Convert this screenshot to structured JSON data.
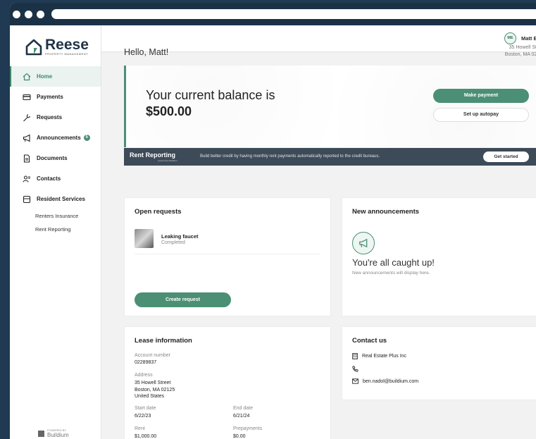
{
  "brand": {
    "name": "Reese",
    "tagline": "PROPERTY MANAGEMENT",
    "accent": "#4b8f75"
  },
  "sidebar": {
    "items": [
      {
        "label": "Home",
        "icon": "home-icon",
        "active": true
      },
      {
        "label": "Payments",
        "icon": "credit-card-icon"
      },
      {
        "label": "Requests",
        "icon": "wrench-icon"
      },
      {
        "label": "Announcements",
        "icon": "megaphone-icon",
        "badge": "5"
      },
      {
        "label": "Documents",
        "icon": "document-icon"
      },
      {
        "label": "Contacts",
        "icon": "contacts-icon"
      },
      {
        "label": "Resident Services",
        "icon": "services-icon"
      }
    ],
    "sub_items": [
      "Renters Insurance",
      "Rent Reporting"
    ],
    "powered_by": {
      "small": "POWERED BY",
      "name": "Buildium"
    }
  },
  "topbar": {
    "initials": "ME",
    "username": "Matt E"
  },
  "main": {
    "greeting": "Hello, Matt!",
    "address_line1": "35 Howell Street",
    "address_line2": "Boston, MA 02125"
  },
  "balance": {
    "label": "Your current balance is",
    "amount": "$500.00",
    "pay_button": "Make payment",
    "autopay_button": "Set up autopay"
  },
  "rent_reporting": {
    "title": "Rent Reporting",
    "powered": "powered by Buildium",
    "text": "Build better credit by having monthly rent payments automatically reported to the credit bureaus.",
    "button": "Get started"
  },
  "requests": {
    "title": "Open requests",
    "item_title": "Leaking faucet",
    "item_status": "Completed",
    "create_button": "Create request"
  },
  "announcements": {
    "title": "New announcements",
    "empty_title": "You're all caught up!",
    "empty_sub": "New announcements will display here."
  },
  "lease": {
    "title": "Lease information",
    "account_label": "Account number",
    "account_value": "02289837",
    "address_label": "Address",
    "address_1": "35 Howell Street",
    "address_2": "Boston, MA 02125",
    "address_3": "United States",
    "start_label": "Start date",
    "start_value": "6/22/23",
    "end_label": "End date",
    "end_value": "6/21/24",
    "rent_label": "Rent",
    "rent_value": "$1,000.00",
    "prepay_label": "Prepayments",
    "prepay_value": "$0.00"
  },
  "contact": {
    "title": "Contact us",
    "company": "Real Estate Plus Inc",
    "email": "ben.nadol@buildium.com"
  }
}
